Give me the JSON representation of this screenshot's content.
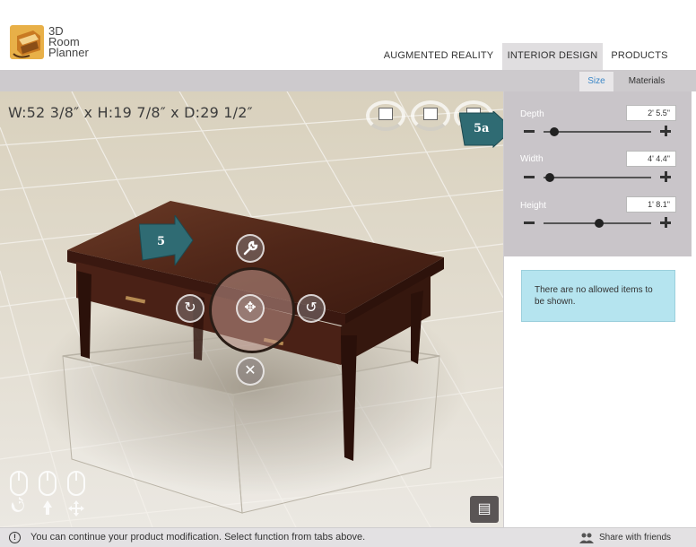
{
  "logo": {
    "line1": "3D",
    "line2": "Room",
    "line3": "Planner"
  },
  "top_tabs": {
    "ar": "AUGMENTED REALITY",
    "interior": "INTERIOR DESIGN",
    "products": "PRODUCTS",
    "active": "INTERIOR DESIGN"
  },
  "sub_tabs": {
    "size": "Size",
    "materials": "Materials",
    "active": "Size"
  },
  "viewport": {
    "dimensions": "W:52 3/8″ x H:19 7/8″ x D:29 1/2″",
    "callout_a": "5a",
    "callout_b": "5"
  },
  "size_panel": {
    "depth": {
      "label": "Depth",
      "value": "2' 5.5\"",
      "slider_fraction": 0.06
    },
    "width": {
      "label": "Width",
      "value": "4' 4.4\"",
      "slider_fraction": 0.02
    },
    "height": {
      "label": "Height",
      "value": "1' 8.1\"",
      "slider_fraction": 0.52
    }
  },
  "info_message": "There are no allowed items to be shown.",
  "status": {
    "message": "You can continue your product modification. Select function from tabs above.",
    "share": "Share with friends"
  },
  "colors": {
    "accent_blue": "#3b87c7",
    "callout_teal": "#2f6b73",
    "info_bg": "#b5e4ef",
    "panel_gray": "#c9c5c9"
  },
  "icons": {
    "logo": "armchair-logo-icon",
    "wrench": "wrench-icon",
    "rotate_left": "rotate-cw-icon",
    "rotate_right": "rotate-ccw-icon",
    "move": "move-arrows-icon",
    "delete": "close-icon",
    "help": "book-icon",
    "share": "people-icon",
    "status": "info-icon"
  }
}
